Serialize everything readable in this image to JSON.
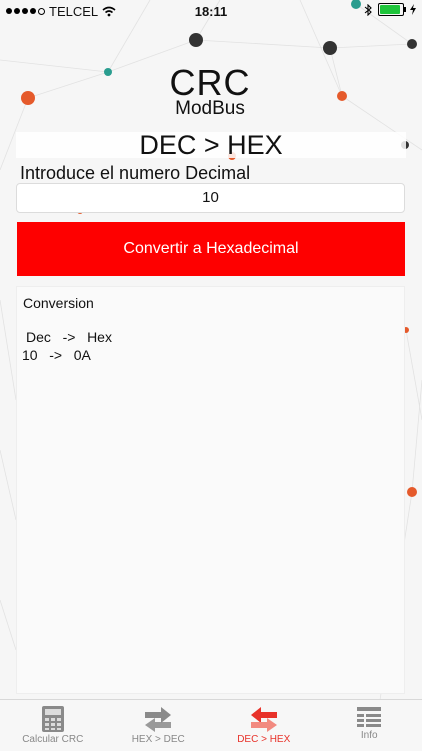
{
  "status_bar": {
    "carrier": "TELCEL",
    "time": "18:11"
  },
  "logo": {
    "main": "CRC",
    "sub": "ModBus"
  },
  "page": {
    "title": "DEC > HEX",
    "input_label": "Introduce el numero Decimal",
    "input_value": "10",
    "convert_button": "Convertir a Hexadecimal"
  },
  "result": {
    "title": "Conversion",
    "line1": "Dec   ->   Hex",
    "line2": "10   ->   0A"
  },
  "tabbar": {
    "tabs": [
      {
        "label": "Calcular CRC",
        "icon": "calculator-icon"
      },
      {
        "label": "HEX > DEC",
        "icon": "swap-arrows-icon"
      },
      {
        "label": "DEC > HEX",
        "icon": "swap-arrows-icon",
        "active": true
      },
      {
        "label": "Info",
        "icon": "list-icon"
      }
    ]
  },
  "colors": {
    "accent": "#fe0000",
    "active_tab": "#e8322a"
  }
}
